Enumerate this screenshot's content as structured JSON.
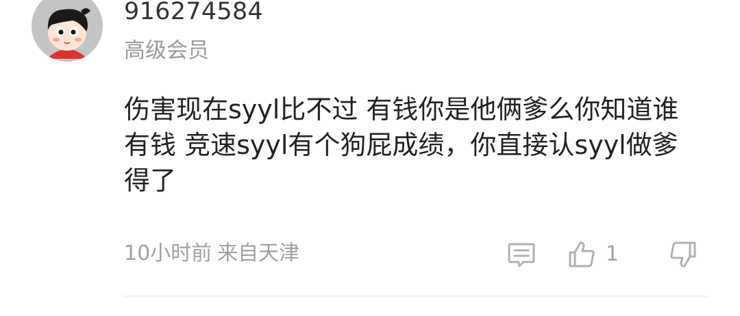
{
  "comment": {
    "user": {
      "name": "916274584",
      "level": "高级会员"
    },
    "text_lines": [
      "伤害现在syyl比不过 有钱你是他俩爹么你知道谁",
      "有钱 竞速syyl有个狗屁成绩，你直接认syyl做爹",
      "得了"
    ],
    "time": "10小时前",
    "location": "来自天津",
    "like_count": "1"
  },
  "icons": {
    "reply": "reply-comment-icon",
    "like": "thumbs-up-icon",
    "dislike": "thumbs-down-icon"
  },
  "colors": {
    "text_primary": "#222222",
    "text_secondary": "#a0a0a0",
    "icon": "#b0b0b0"
  }
}
